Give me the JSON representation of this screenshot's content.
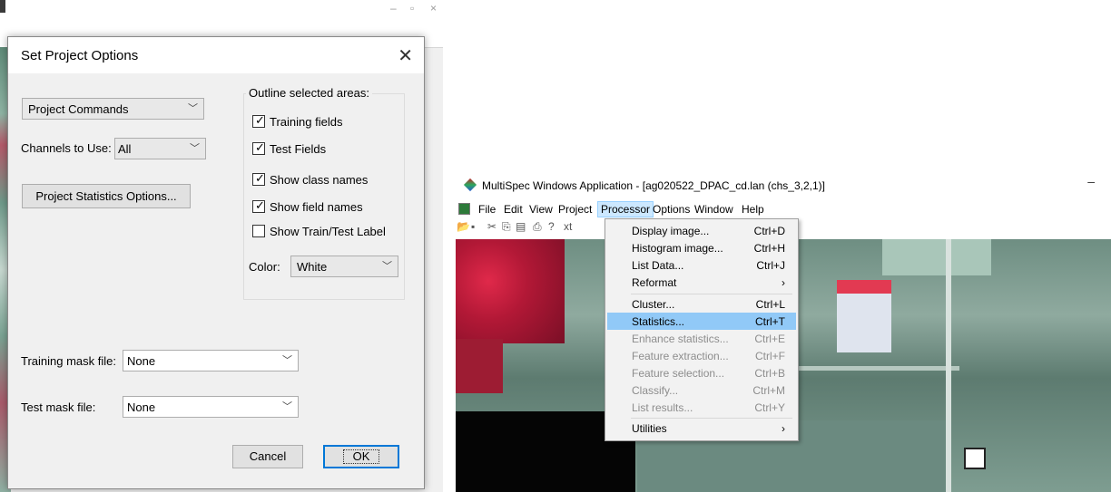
{
  "dialog": {
    "title": "Set Project Options",
    "close_glyph": "✕",
    "project_commands": {
      "value": "Project Commands"
    },
    "channels": {
      "label": "Channels to Use:",
      "value": "All"
    },
    "stats_button": "Project Statistics Options...",
    "outline_group": {
      "title": "Outline selected areas:",
      "checkboxes": [
        {
          "label": "Training fields",
          "checked": true
        },
        {
          "label": "Test Fields",
          "checked": true
        },
        {
          "label": "Show class names",
          "checked": true
        },
        {
          "label": "Show field names",
          "checked": true
        },
        {
          "label": "Show Train/Test Label",
          "checked": false
        }
      ],
      "color_label": "Color:",
      "color_value": "White"
    },
    "training_mask": {
      "label": "Training mask file:",
      "value": "None"
    },
    "test_mask": {
      "label": "Test mask file:",
      "value": "None"
    },
    "cancel_label": "Cancel",
    "ok_label": "OK"
  },
  "multispec": {
    "title": "MultiSpec Windows Application - [ag020522_DPAC_cd.lan (chs_3,2,1)]",
    "minimize_glyph": "–",
    "menus": [
      {
        "label": "File",
        "key": "F"
      },
      {
        "label": "Edit",
        "key": "E"
      },
      {
        "label": "View",
        "key": "V"
      },
      {
        "label": "Project",
        "key": ""
      },
      {
        "label": "Processor",
        "key": ""
      },
      {
        "label": "Options",
        "key": "O"
      },
      {
        "label": "Window",
        "key": "W"
      },
      {
        "label": "Help",
        "key": "H"
      }
    ],
    "toolbar_tail": "xt",
    "processor_menu": [
      {
        "label": "Display image...",
        "shortcut": "Ctrl+D",
        "enabled": true
      },
      {
        "label": "Histogram image...",
        "shortcut": "Ctrl+H",
        "enabled": true
      },
      {
        "label": "List Data...",
        "shortcut": "Ctrl+J",
        "enabled": true
      },
      {
        "label": "Reformat",
        "shortcut": "›",
        "enabled": true
      },
      {
        "label": "Cluster...",
        "shortcut": "Ctrl+L",
        "enabled": true
      },
      {
        "label": "Statistics...",
        "shortcut": "Ctrl+T",
        "enabled": true,
        "highlighted": true
      },
      {
        "label": "Enhance statistics...",
        "shortcut": "Ctrl+E",
        "enabled": false
      },
      {
        "label": "Feature extraction...",
        "shortcut": "Ctrl+F",
        "enabled": false
      },
      {
        "label": "Feature selection...",
        "shortcut": "Ctrl+B",
        "enabled": false
      },
      {
        "label": "Classify...",
        "shortcut": "Ctrl+M",
        "enabled": false
      },
      {
        "label": "List results...",
        "shortcut": "Ctrl+Y",
        "enabled": false
      },
      {
        "label": "Utilities",
        "shortcut": "›",
        "enabled": true
      }
    ]
  },
  "colors": {
    "accent": "#0078d7",
    "menu_highlight": "#91c9f7"
  }
}
